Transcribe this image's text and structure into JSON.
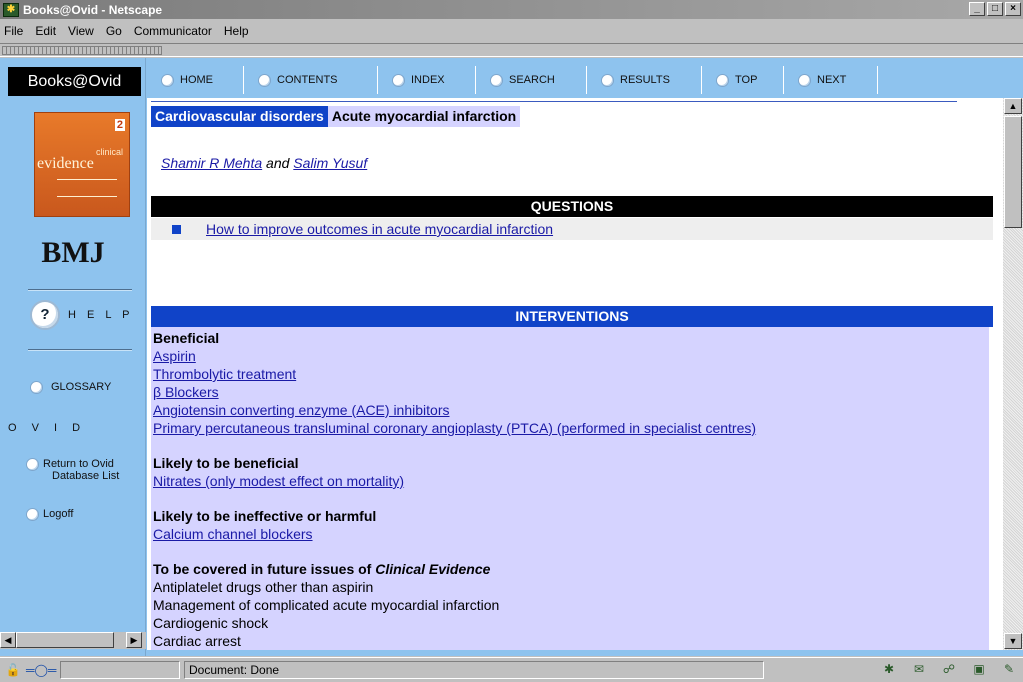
{
  "window": {
    "title": "Books@Ovid - Netscape",
    "minimize": "_",
    "maximize": "□",
    "close": "×"
  },
  "menu": [
    "File",
    "Edit",
    "View",
    "Go",
    "Communicator",
    "Help"
  ],
  "sidebar": {
    "brand": "Books@Ovid",
    "cover": {
      "edition": "2",
      "clinical": "clinical",
      "evidence": "evidence"
    },
    "publisher": "BMJ",
    "help": {
      "icon_text": "?",
      "label": "H E L P"
    },
    "glossary": "GLOSSARY",
    "ovid": "O V I D",
    "return_line1": "Return to Ovid",
    "return_line2": "Database List",
    "logoff": "Logoff"
  },
  "nav": [
    "HOME",
    "CONTENTS",
    "INDEX",
    "SEARCH",
    "RESULTS",
    "TOP",
    "NEXT"
  ],
  "breadcrumb": {
    "section": "Cardiovascular disorders",
    "topic": "Acute myocardial infarction"
  },
  "authors": {
    "author1": "Shamir R Mehta",
    "conj": "and",
    "author2": "Salim Yusuf"
  },
  "questions": {
    "header": "QUESTIONS",
    "items": [
      "How to improve outcomes in acute myocardial infarction"
    ]
  },
  "interventions": {
    "header": "INTERVENTIONS",
    "beneficial": {
      "heading": "Beneficial",
      "items": [
        "Aspirin",
        "Thrombolytic treatment",
        "β Blockers",
        "Angiotensin converting enzyme (ACE) inhibitors",
        "Primary percutaneous transluminal coronary angioplasty (PTCA) (performed in specialist centres)"
      ]
    },
    "likely": {
      "heading": "Likely to be beneficial",
      "items": [
        "Nitrates (only modest effect on mortality)"
      ]
    },
    "ineffective": {
      "heading": "Likely to be ineffective or harmful",
      "items": [
        "Calcium channel blockers"
      ]
    },
    "future": {
      "heading_prefix": "To be covered in future issues of",
      "heading_title": "Clinical Evidence",
      "items": [
        "Antiplatelet drugs other than aspirin",
        "Management of complicated acute myocardial infarction",
        "Cardiogenic shock",
        "Cardiac arrest"
      ]
    }
  },
  "status": {
    "text": "Document: Done"
  },
  "colors": {
    "sidebar": "#8ec3ee",
    "header_blue": "#1043c8",
    "panel_lavender": "#d5d3ff",
    "link": "#1a1aa6"
  }
}
